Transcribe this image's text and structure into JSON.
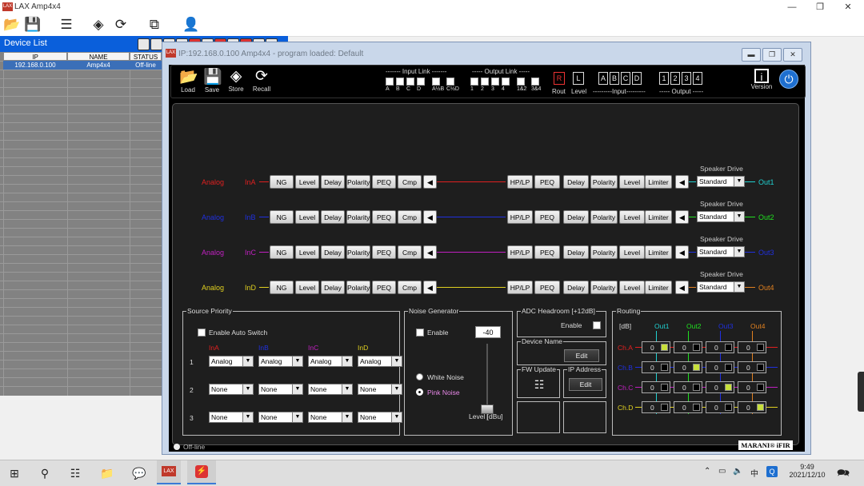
{
  "window": {
    "title": "LAX Amp4x4",
    "logo": "LAX"
  },
  "toolbar_icons": [
    "open-icon",
    "save-icon",
    "add-device-icon",
    "network-icon",
    "refresh-icon",
    "copy-icon",
    "user-settings-icon"
  ],
  "device_list": {
    "title": "Device List",
    "columns": [
      "IP",
      "NAME",
      "STATUS"
    ],
    "rows": [
      {
        "ip": "192.168.0.100",
        "name": "Amp4x4",
        "status": "Off-line"
      }
    ]
  },
  "mdi": {
    "title": "IP:192.168.0.100 Amp4x4 - program loaded: Default"
  },
  "panel_toolbar": {
    "buttons": [
      {
        "label": "Load"
      },
      {
        "label": "Save"
      },
      {
        "label": "Store"
      },
      {
        "label": "Recall"
      }
    ],
    "input_link": {
      "title": "------- Input Link -------",
      "labels": [
        "A",
        "B",
        "C",
        "D",
        "A½B",
        "C½D"
      ]
    },
    "output_link": {
      "title": "----- Output Link -----",
      "labels": [
        "1",
        "2",
        "3",
        "4",
        "1&2",
        "3&4"
      ]
    },
    "rout": {
      "r": "R",
      "l": "L",
      "rout": "Rout",
      "level": "Level"
    },
    "input_sel": {
      "letters": [
        "A",
        "B",
        "C",
        "D"
      ],
      "label": "---------Input---------"
    },
    "output_sel": {
      "numbers": [
        "1",
        "2",
        "3",
        "4"
      ],
      "label": "----- Output -----"
    },
    "version": {
      "icon": "i",
      "label": "Version"
    }
  },
  "channels": [
    {
      "source": "Analog",
      "input": "InA",
      "output": "Out1",
      "color": "#e02020",
      "speaker": "Standard"
    },
    {
      "source": "Analog",
      "input": "InB",
      "output": "Out2",
      "color": "#2030e0",
      "speaker": "Standard"
    },
    {
      "source": "Analog",
      "input": "InC",
      "output": "Out3",
      "color": "#c020c0",
      "speaker": "Standard"
    },
    {
      "source": "Analog",
      "input": "InD",
      "output": "Out4",
      "color": "#e0d020",
      "speaker": "Standard"
    }
  ],
  "output_colors": [
    "#20d0d0",
    "#20e020",
    "#2030e0",
    "#e08020"
  ],
  "input_blocks": [
    "NG",
    "Level",
    "Delay",
    "Polarity",
    "PEQ",
    "Cmp"
  ],
  "output_blocks": [
    "HP/LP",
    "PEQ",
    "Delay",
    "Polarity",
    "Level",
    "Limiter"
  ],
  "speaker_drive_label": "Speaker Drive",
  "source_priority": {
    "title": "Source Priority",
    "auto_switch": "Enable Auto Switch",
    "headers": [
      "InA",
      "InB",
      "InC",
      "InD"
    ],
    "rows": [
      {
        "num": "1",
        "values": [
          "Analog",
          "Analog",
          "Analog",
          "Analog"
        ]
      },
      {
        "num": "2",
        "values": [
          "None",
          "None",
          "None",
          "None"
        ]
      },
      {
        "num": "3",
        "values": [
          "None",
          "None",
          "None",
          "None"
        ]
      }
    ]
  },
  "noise_generator": {
    "title": "Noise Generator",
    "enable": "Enable",
    "value": "-40",
    "white": "White Noise",
    "pink": "Pink Noise",
    "level_label": "Level [dBu]",
    "level_fraction": 0.85
  },
  "adc": {
    "title": "ADC Headroom [+12dB]",
    "enable": "Enable"
  },
  "device_name": {
    "title": "Device Name",
    "edit": "Edit"
  },
  "fw_update": {
    "title": "FW Update"
  },
  "ip_address": {
    "title": "IP Address",
    "edit": "Edit"
  },
  "routing": {
    "title": "Routing",
    "unit": "[dB]",
    "outputs": [
      "Out1",
      "Out2",
      "Out3",
      "Out4"
    ],
    "inputs": [
      "Ch.A",
      "Ch.B",
      "Ch.C",
      "Ch.D"
    ],
    "input_colors": [
      "#e02020",
      "#2030e0",
      "#c020c0",
      "#e0d020"
    ],
    "cell_value": "0",
    "matrix": [
      [
        true,
        false,
        false,
        false
      ],
      [
        false,
        true,
        false,
        false
      ],
      [
        false,
        false,
        true,
        false
      ],
      [
        false,
        false,
        false,
        true
      ]
    ]
  },
  "status": {
    "text": "Off-line",
    "brand": "MARANI® iFIR"
  },
  "taskbar": {
    "icons": [
      "windows-icon",
      "search-icon",
      "task-view-icon",
      "file-explorer-icon",
      "wechat-icon",
      "lax-app-icon",
      "app-icon"
    ],
    "lax_label": "LAX",
    "ime": "中",
    "time": "9:49",
    "date": "2021/12/10"
  }
}
